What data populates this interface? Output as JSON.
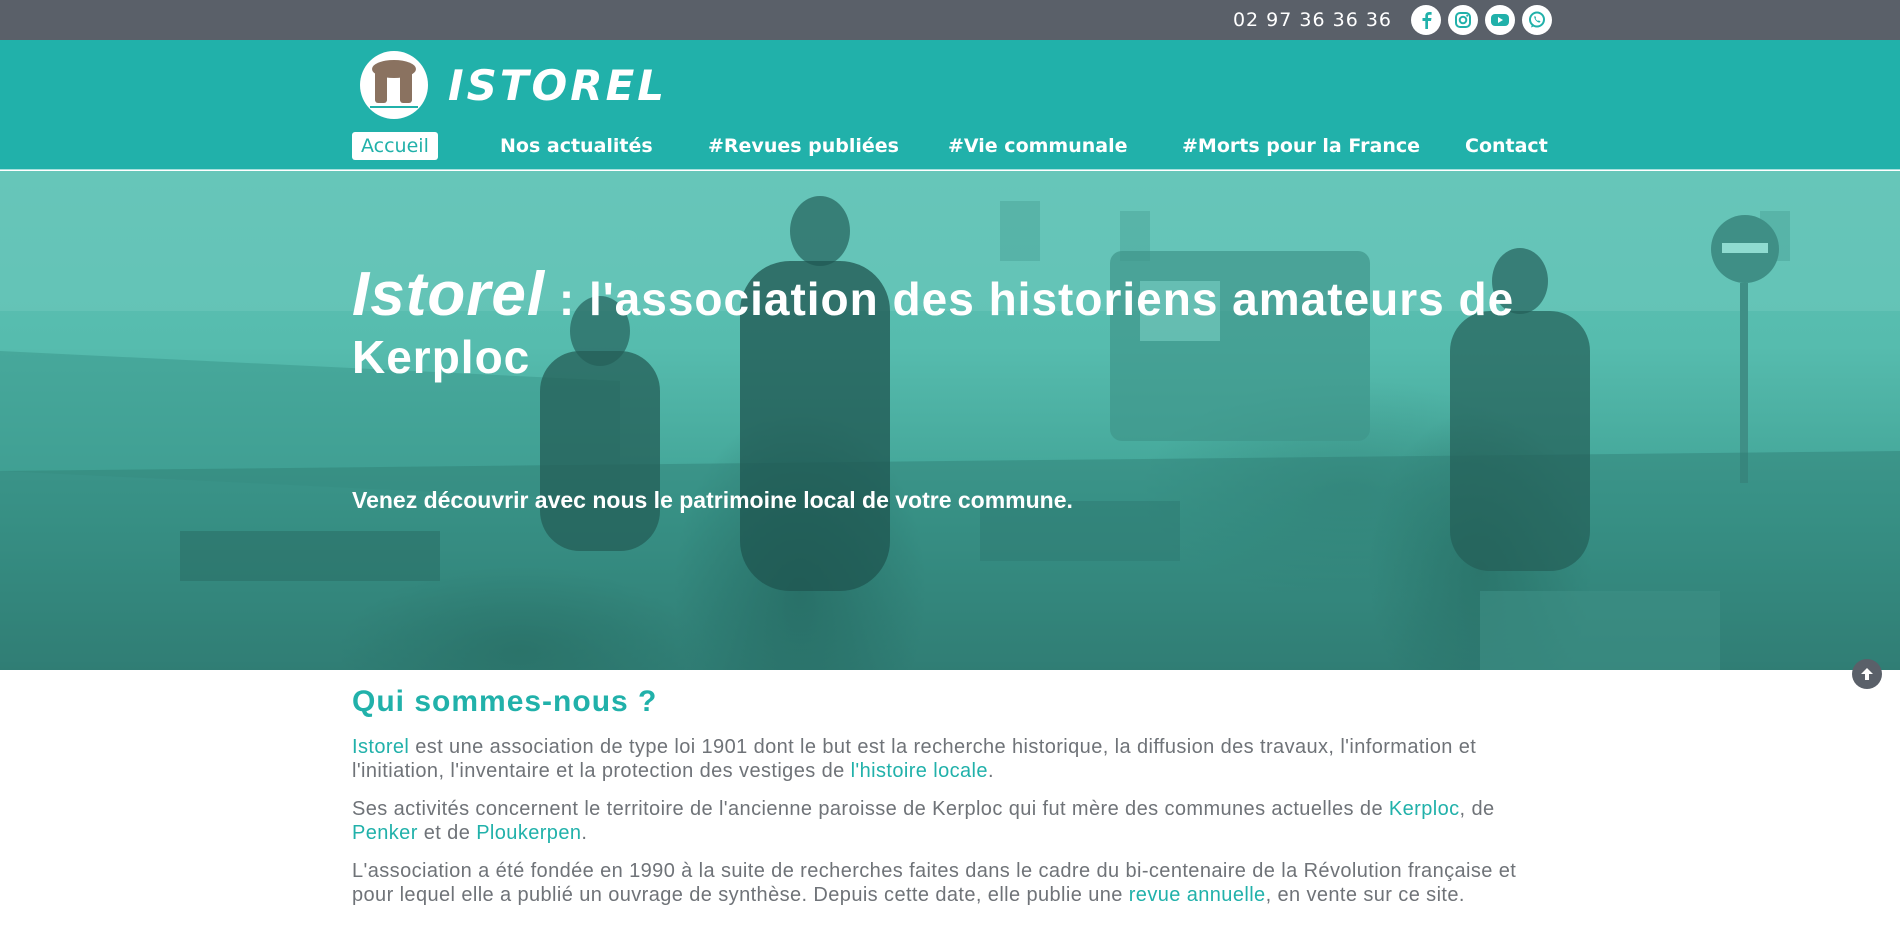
{
  "colors": {
    "accent": "#21b1aa",
    "topbar": "#5a6069",
    "text": "#6f7378"
  },
  "topbar": {
    "phone": "02 97 36 36 36",
    "socials": [
      "facebook-icon",
      "instagram-icon",
      "youtube-icon",
      "whatsapp-icon"
    ]
  },
  "header": {
    "site_title": "ISTOREL",
    "nav": [
      {
        "label": "Accueil",
        "active": true
      },
      {
        "label": "Nos actualités"
      },
      {
        "label": "#Revues publiées"
      },
      {
        "label": "#Vie communale"
      },
      {
        "label": "#Morts pour la France"
      },
      {
        "label": "Contact"
      }
    ]
  },
  "hero": {
    "brand": "Istorel",
    "title_rest": " : l'association des historiens amateurs de Kerploc",
    "subtitle": "Venez découvrir avec nous le patrimoine local de votre commune."
  },
  "main": {
    "section_title": "Qui sommes-nous ?",
    "p1": {
      "link1": "Istorel",
      "text1": " est une association de type loi 1901 dont le but est la recherche historique, la diffusion des travaux, l'information et l'initiation, l'inventaire et la protection des vestiges de ",
      "link2": "l'histoire locale",
      "text2": "."
    },
    "p2": {
      "text1": "Ses activités concernent le territoire de l'ancienne paroisse de Kerploc qui fut mère des communes actuelles de ",
      "link1": "Kerploc",
      "text2": ", de ",
      "link2": "Penker",
      "text3": " et de ",
      "link3": "Ploukerpen",
      "text4": "."
    },
    "p3": {
      "text1": "L'association a été fondée en 1990 à la suite de recherches faites dans le cadre du bi-centenaire de la Révolution française et pour lequel elle a publié un ouvrage de synthèse. Depuis cette date, elle publie une ",
      "link1": "revue annuelle",
      "text2": ", en vente sur ce site."
    }
  }
}
